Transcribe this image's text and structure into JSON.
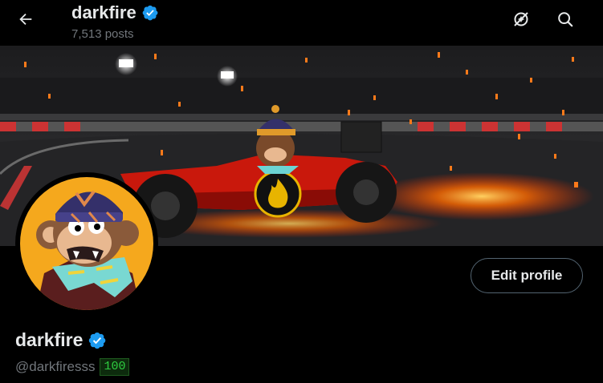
{
  "header": {
    "back_icon": "arrow-left-icon",
    "display_name": "darkfire",
    "posts_count": "7,513 posts",
    "verified_icon": "verified-badge-icon",
    "right_icons": [
      "no-ai-icon",
      "search-icon"
    ]
  },
  "banner": {
    "description_icon": "flame-icon"
  },
  "profile": {
    "display_name": "darkfire",
    "handle": "@darkfiresss",
    "score_badge": "100",
    "edit_button": "Edit profile"
  },
  "colors": {
    "background": "#000000",
    "text_primary": "#e7e9ea",
    "text_secondary": "#71767b",
    "verified": "#1d9bf0",
    "badge_green": "#2ecc40",
    "avatar_bg": "#f5a81d"
  }
}
